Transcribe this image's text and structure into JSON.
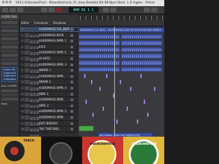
{
  "window": {
    "title": "1913 UnknownProd - Mixenthetrack, Ft. Joey Bada$$ BX 89 Bpm Beat. L.P. Ingles - Pistas"
  },
  "transport": {
    "lcd_text": "000 01 1 1"
  },
  "inspector": {
    "header": "AUDIO DAS",
    "box_lines": [
      "Comp OK / Rec",
      "Channel EQ",
      "Channel EQ",
      "Compressor"
    ],
    "label": "Bus 16 BPM",
    "sublabel": "Bass"
  },
  "menu": {
    "items": [
      "Editar",
      "Funciones",
      "Visualizar"
    ]
  },
  "tracks": [
    {
      "n": "1",
      "name": "AUDIOMASS FUL_BEAT"
    },
    {
      "n": "2",
      "name": "AUDIOMASS BASS"
    },
    {
      "n": "3",
      "name": "AUDIOMASS SMPL 1"
    },
    {
      "n": "4",
      "name": "KICK"
    },
    {
      "n": "5",
      "name": "AUDIOMASS SMPL 2"
    },
    {
      "n": "6",
      "name": "HI HATS"
    },
    {
      "n": "7",
      "name": "AUDIOMASS SMPL 3"
    },
    {
      "n": "8",
      "name": "SNARE 1"
    },
    {
      "n": "9",
      "name": "AUDIOMASS SMPL"
    },
    {
      "n": "10",
      "name": "SNARE 2"
    },
    {
      "n": "11",
      "name": "AUDIOMASS SMPL 4"
    },
    {
      "n": "12",
      "name": "SNPL 1"
    },
    {
      "n": "13",
      "name": "AUDIOMASS SMPL"
    },
    {
      "n": "14",
      "name": "SNPL 2"
    },
    {
      "n": "15",
      "name": "AUDIOMASS SMPL 2"
    },
    {
      "n": "16",
      "name": "AUDIOMASS SMPL"
    },
    {
      "n": "17",
      "name": "JOEY BADASS"
    },
    {
      "n": "18",
      "name": "TAG THECONS..."
    }
  ],
  "regions": {
    "top_label": "AUDIOMASS FULL BEAT... INSTRUMENTAL RAP HIP HOP BOOM BAP SAMPLE",
    "vocal_label": "Joey Badass - Dear Hip Hop(MV).M4A",
    "tag_label": "Tag"
  },
  "artwork": {
    "labels": [
      "TRACK",
      "UNKNOWNPROD",
      "UNKNOWNPROD"
    ]
  },
  "colors": {
    "audio_region": "#4a5ba8",
    "midi_region": "#8e62c9",
    "green_region": "#4aa84a",
    "yellow_region": "#b5a437"
  }
}
